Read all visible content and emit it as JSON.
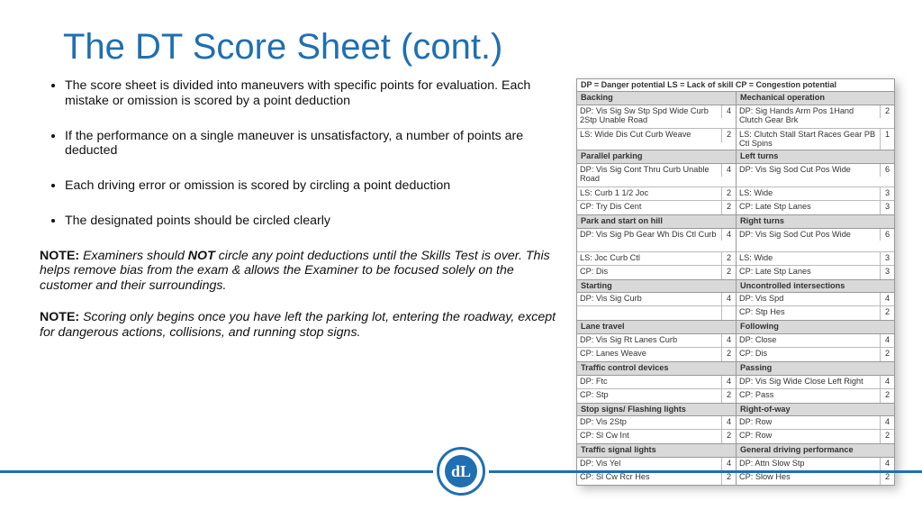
{
  "title": "The DT Score Sheet (cont.)",
  "bullets": [
    "The score sheet is divided into maneuvers with specific points for evaluation. Each mistake or omission is scored by a point deduction",
    "If the performance on a single maneuver is unsatisfactory, a number of points are deducted",
    "Each driving error or omission is scored by circling a point deduction",
    "The designated points should be circled clearly"
  ],
  "note1_lead": "NOTE:",
  "note1_a": "  Examiners should ",
  "note1_b": "NOT",
  "note1_c": " circle any point deductions until the Skills Test is over. This helps remove bias from the exam & allows the Examiner to be focused solely on the customer and their surroundings.",
  "note2_lead": "NOTE:",
  "note2": " Scoring only begins once you have left the parking lot, entering the roadway, except for dangerous actions, collisions, and running stop signs.",
  "legend": "DP = Danger potential    LS = Lack of skill    CP = Congestion potential",
  "sections": [
    {
      "left": {
        "head": "Backing",
        "rows": [
          {
            "lbl": "DP: Vis Sig Sw Stp Spd Wide Curb 2Stp Unable Road",
            "pts": "4",
            "dbl": true
          },
          {
            "lbl": "LS: Wide Dis Cut Curb Weave",
            "pts": "2"
          }
        ]
      },
      "right": {
        "head": "Mechanical operation",
        "rows": [
          {
            "lbl": "DP: Sig Hands Arm Pos 1Hand Clutch Gear Brk",
            "pts": "2",
            "dbl": true
          },
          {
            "lbl": "LS: Clutch Stall Start Races Gear PB Ctl Spins",
            "pts": "1"
          }
        ]
      }
    },
    {
      "left": {
        "head": "Parallel parking",
        "rows": [
          {
            "lbl": "DP: Vis Sig Cont Thru Curb Unable Road",
            "pts": "4",
            "dbl": true
          },
          {
            "lbl": "LS: Curb 1 1/2 Joc",
            "pts": "2"
          },
          {
            "lbl": "CP: Try Dis Cent",
            "pts": "2"
          }
        ]
      },
      "right": {
        "head": "Left turns",
        "rows": [
          {
            "lbl": "DP: Vis Sig Sod Cut Pos Wide",
            "pts": "6",
            "dbl": true
          },
          {
            "lbl": "LS: Wide",
            "pts": "3"
          },
          {
            "lbl": "CP: Late Stp Lanes",
            "pts": "3"
          }
        ]
      }
    },
    {
      "left": {
        "head": "Park and start on hill",
        "rows": [
          {
            "lbl": "DP: Vis Sig Pb Gear Wh Dis Ctl Curb",
            "pts": "4",
            "dbl": true
          },
          {
            "lbl": "LS: Joc Curb Ctl",
            "pts": "2"
          },
          {
            "lbl": "CP: Dis",
            "pts": "2"
          }
        ]
      },
      "right": {
        "head": "Right turns",
        "rows": [
          {
            "lbl": "DP: Vis Sig Sod Cut Pos Wide",
            "pts": "6",
            "dbl": true
          },
          {
            "lbl": "LS: Wide",
            "pts": "3"
          },
          {
            "lbl": "CP: Late Stp Lanes",
            "pts": "3"
          }
        ]
      }
    },
    {
      "left": {
        "head": "Starting",
        "rows": [
          {
            "lbl": "DP: Vis Sig Curb",
            "pts": "4"
          },
          {
            "lbl": "",
            "pts": ""
          }
        ]
      },
      "right": {
        "head": "Uncontrolled intersections",
        "rows": [
          {
            "lbl": "DP: Vis Spd",
            "pts": "4"
          },
          {
            "lbl": "CP: Stp Hes",
            "pts": "2"
          }
        ]
      }
    },
    {
      "left": {
        "head": "Lane travel",
        "rows": [
          {
            "lbl": "DP: Vis Sig Rt Lanes Curb",
            "pts": "4"
          },
          {
            "lbl": "CP: Lanes Weave",
            "pts": "2"
          }
        ]
      },
      "right": {
        "head": "Following",
        "rows": [
          {
            "lbl": "DP: Close",
            "pts": "4"
          },
          {
            "lbl": "CP: Dis",
            "pts": "2"
          }
        ]
      }
    },
    {
      "left": {
        "head": "Traffic control devices",
        "rows": [
          {
            "lbl": "DP: Ftc",
            "pts": "4"
          },
          {
            "lbl": "CP: Stp",
            "pts": "2"
          }
        ]
      },
      "right": {
        "head": "Passing",
        "rows": [
          {
            "lbl": "DP: Vis Sig Wide Close Left Right",
            "pts": "4"
          },
          {
            "lbl": "CP: Pass",
            "pts": "2"
          }
        ]
      }
    },
    {
      "left": {
        "head": "Stop signs/ Flashing lights",
        "rows": [
          {
            "lbl": "DP: Vis 2Stp",
            "pts": "4"
          },
          {
            "lbl": "CP: Sl Cw Int",
            "pts": "2"
          }
        ]
      },
      "right": {
        "head": "Right-of-way",
        "rows": [
          {
            "lbl": "DP: Row",
            "pts": "4"
          },
          {
            "lbl": "CP: Row",
            "pts": "2"
          }
        ]
      }
    },
    {
      "left": {
        "head": "Traffic signal lights",
        "rows": [
          {
            "lbl": "DP: Vis Yel",
            "pts": "4"
          },
          {
            "lbl": "CP: Sl Cw Rcr Hes",
            "pts": "2"
          }
        ]
      },
      "right": {
        "head": "General driving performance",
        "rows": [
          {
            "lbl": "DP: Attn Slow Stp",
            "pts": "4"
          },
          {
            "lbl": "CP: Slow Hes",
            "pts": "2"
          }
        ]
      }
    }
  ],
  "logo_text": "dL"
}
